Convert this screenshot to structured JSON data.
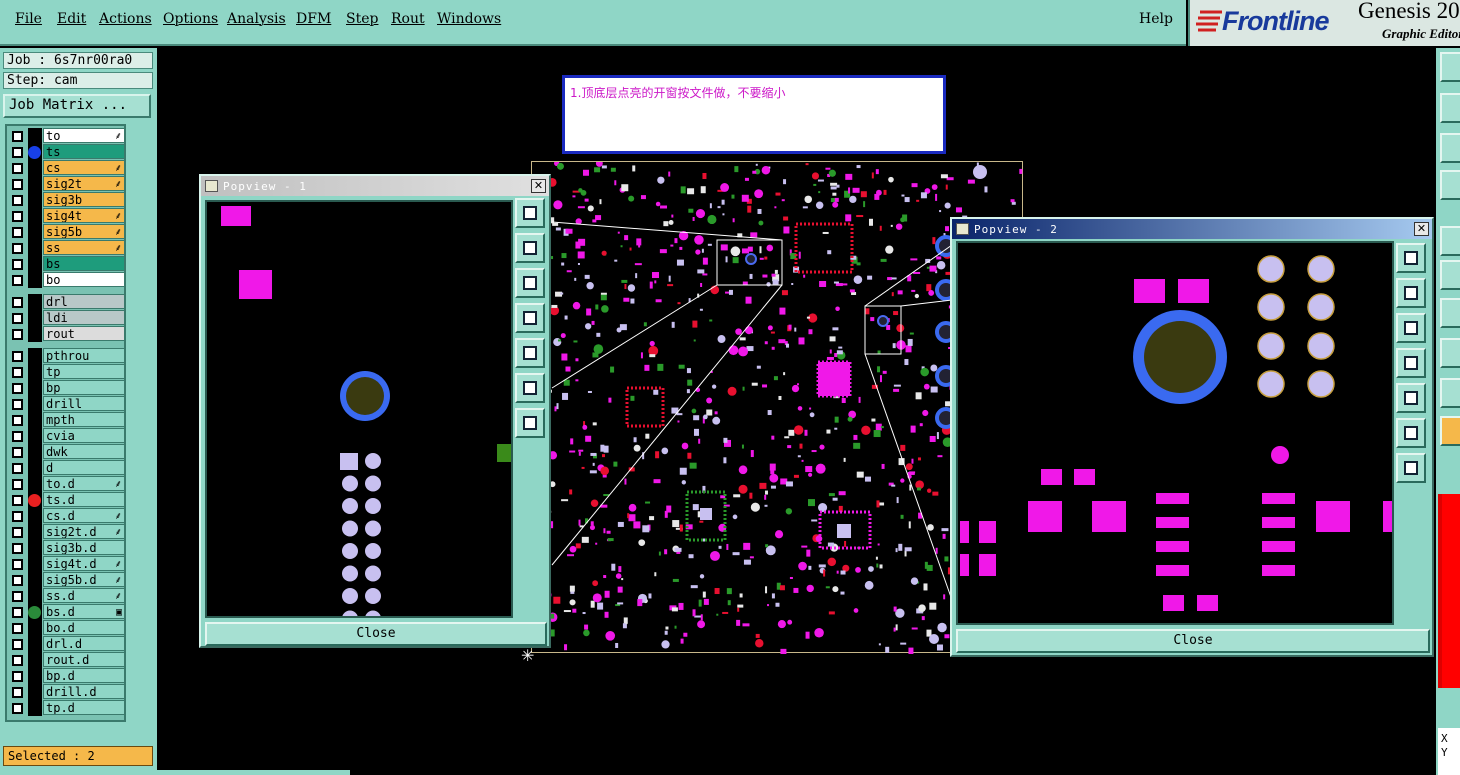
{
  "menu": [
    "File",
    "Edit",
    "Actions",
    "Options",
    "Analysis",
    "DFM",
    "Step",
    "Rout",
    "Windows"
  ],
  "help": "Help",
  "logo": {
    "brand": "Frontline",
    "product": "Genesis 20",
    "subtitle": "Graphic Editor"
  },
  "job_label": "Job : 6s7nr00ra0",
  "step_label": "Step: cam",
  "job_matrix": "Job Matrix ...",
  "layers": [
    {
      "name": "to",
      "color": "#ffffff",
      "dot": "",
      "mark": "⸙"
    },
    {
      "name": "ts",
      "color": "#1e9c7c",
      "dot": "#1840e8",
      "mark": ""
    },
    {
      "name": "cs",
      "color": "#f5b84a",
      "dot": "",
      "mark": "⸙"
    },
    {
      "name": "sig2t",
      "color": "#f5b84a",
      "dot": "",
      "mark": "⸙"
    },
    {
      "name": "sig3b",
      "color": "#f5b84a",
      "dot": "",
      "mark": ""
    },
    {
      "name": "sig4t",
      "color": "#f5b84a",
      "dot": "",
      "mark": "⸙"
    },
    {
      "name": "sig5b",
      "color": "#f5b84a",
      "dot": "",
      "mark": "⸙"
    },
    {
      "name": "ss",
      "color": "#f5b84a",
      "dot": "",
      "mark": "⸙"
    },
    {
      "name": "bs",
      "color": "#1e9c7c",
      "dot": "",
      "mark": ""
    },
    {
      "name": "bo",
      "color": "#ffffff",
      "dot": "",
      "mark": ""
    },
    {
      "name": "drl",
      "color": "#b8c8c8",
      "dot": "",
      "mark": ""
    },
    {
      "name": "ldi",
      "color": "#b8c8c8",
      "dot": "",
      "mark": ""
    },
    {
      "name": "rout",
      "color": "#dcdcdc",
      "dot": "",
      "mark": ""
    },
    {
      "name": "pthrou",
      "color": "#8fd6c6",
      "dot": "",
      "mark": ""
    },
    {
      "name": "tp",
      "color": "#8fd6c6",
      "dot": "",
      "mark": ""
    },
    {
      "name": "bp",
      "color": "#8fd6c6",
      "dot": "",
      "mark": ""
    },
    {
      "name": "drill",
      "color": "#8fd6c6",
      "dot": "",
      "mark": ""
    },
    {
      "name": "mpth",
      "color": "#8fd6c6",
      "dot": "",
      "mark": ""
    },
    {
      "name": "cvia",
      "color": "#8fd6c6",
      "dot": "",
      "mark": ""
    },
    {
      "name": "dwk",
      "color": "#8fd6c6",
      "dot": "",
      "mark": ""
    },
    {
      "name": "d",
      "color": "#8fd6c6",
      "dot": "",
      "mark": ""
    },
    {
      "name": "to.d",
      "color": "#8fd6c6",
      "dot": "",
      "mark": "⸙"
    },
    {
      "name": "ts.d",
      "color": "#8fd6c6",
      "dot": "#e82020",
      "mark": ""
    },
    {
      "name": "cs.d",
      "color": "#8fd6c6",
      "dot": "",
      "mark": "⸙"
    },
    {
      "name": "sig2t.d",
      "color": "#8fd6c6",
      "dot": "",
      "mark": "⸙"
    },
    {
      "name": "sig3b.d",
      "color": "#8fd6c6",
      "dot": "",
      "mark": ""
    },
    {
      "name": "sig4t.d",
      "color": "#8fd6c6",
      "dot": "",
      "mark": "⸙"
    },
    {
      "name": "sig5b.d",
      "color": "#8fd6c6",
      "dot": "",
      "mark": "⸙"
    },
    {
      "name": "ss.d",
      "color": "#8fd6c6",
      "dot": "",
      "mark": "⸙"
    },
    {
      "name": "bs.d",
      "color": "#8fd6c6",
      "dot": "#2a8a3a",
      "mark": "▣"
    },
    {
      "name": "bo.d",
      "color": "#8fd6c6",
      "dot": "",
      "mark": ""
    },
    {
      "name": "drl.d",
      "color": "#8fd6c6",
      "dot": "",
      "mark": ""
    },
    {
      "name": "rout.d",
      "color": "#8fd6c6",
      "dot": "",
      "mark": ""
    },
    {
      "name": "bp.d",
      "color": "#8fd6c6",
      "dot": "",
      "mark": ""
    },
    {
      "name": "drill.d",
      "color": "#8fd6c6",
      "dot": "",
      "mark": ""
    },
    {
      "name": "tp.d",
      "color": "#8fd6c6",
      "dot": "",
      "mark": ""
    }
  ],
  "selected": "Selected : 2",
  "note": "1.顶底层点亮的开窗按文件做，不要缩小",
  "popview1": {
    "title": "Popview - 1",
    "close": "Close"
  },
  "popview2": {
    "title": "Popview - 2",
    "close": "Close"
  },
  "coords": {
    "x": "X",
    "y": "Y"
  },
  "colors": {
    "panel": "#8fd6c6",
    "pad": "#f018e8",
    "via": "#c8c0f0",
    "ring": "#3a6af0",
    "drill": "#3a3a10"
  }
}
